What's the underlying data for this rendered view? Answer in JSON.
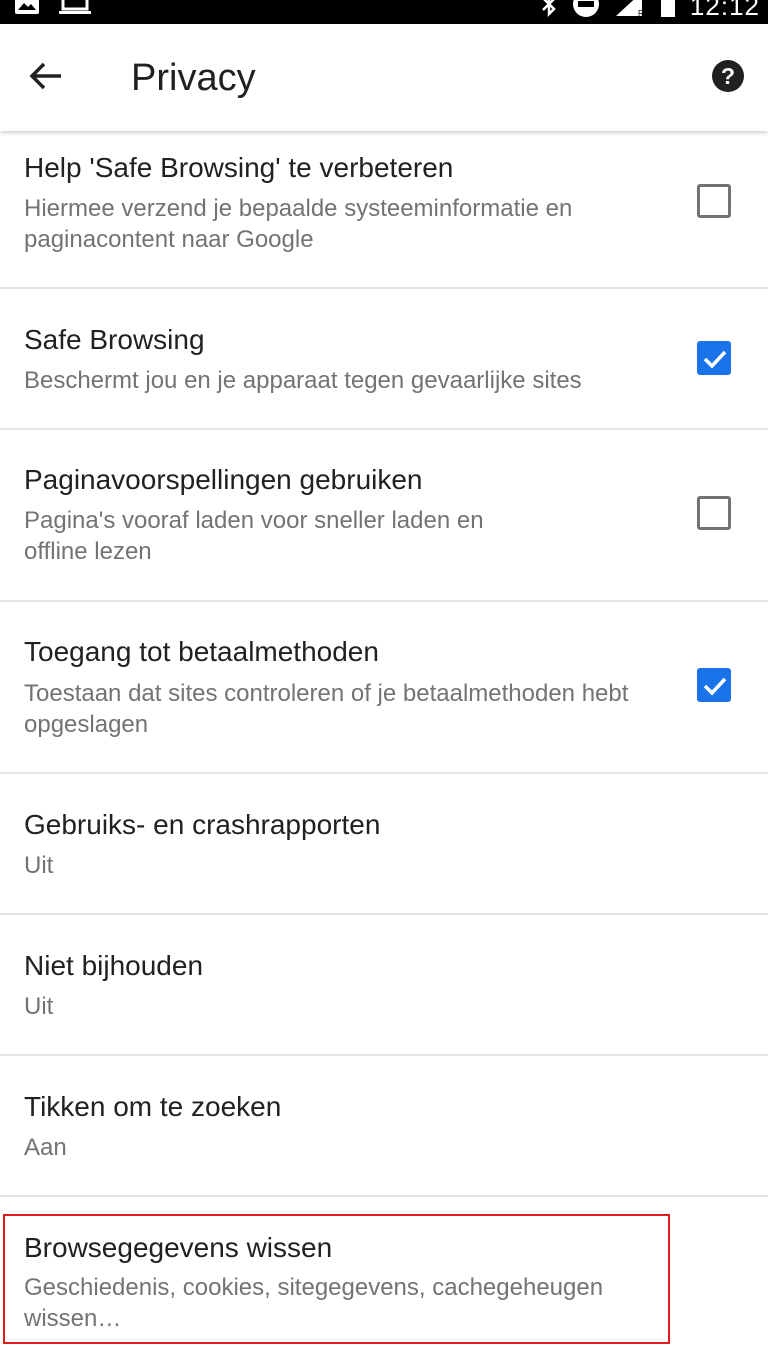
{
  "status_bar": {
    "time": "12:12",
    "left_icons": [
      "image-icon",
      "laptop-icon"
    ],
    "right_icons": [
      "bluetooth-icon",
      "do-not-disturb-icon",
      "signal-icon",
      "battery-icon"
    ]
  },
  "app_bar": {
    "title": "Privacy",
    "back_icon": "arrow-back-icon",
    "help_icon": "help-icon"
  },
  "settings": [
    {
      "title": "Help 'Safe Browsing' te verbeteren",
      "summary": "Hiermee verzend je bepaalde systeeminformatie en paginacontent naar Google",
      "checkbox": false
    },
    {
      "title": "Safe Browsing",
      "summary": "Beschermt jou en je apparaat tegen gevaarlijke sites",
      "checkbox": true
    },
    {
      "title": "Paginavoorspellingen gebruiken",
      "summary": "Pagina's vooraf laden voor sneller laden en offline lezen",
      "checkbox": false
    },
    {
      "title": "Toegang tot betaalmethoden",
      "summary": "Toestaan dat sites controleren of je betaalmethoden hebt opgeslagen",
      "checkbox": true
    },
    {
      "title": "Gebruiks- en crashrapporten",
      "summary": "Uit"
    },
    {
      "title": "Niet bijhouden",
      "summary": "Uit"
    },
    {
      "title": "Tikken om te zoeken",
      "summary": "Aan"
    },
    {
      "title": "Browsegegevens wissen",
      "summary": "Geschiedenis, cookies, sitegegevens, cachegeheugen wissen…"
    }
  ],
  "colors": {
    "accent": "#1a73e8",
    "highlight": "#e01b1b",
    "divider": "#e4e4e4",
    "title_text": "#212121",
    "summary_text": "#737373"
  }
}
